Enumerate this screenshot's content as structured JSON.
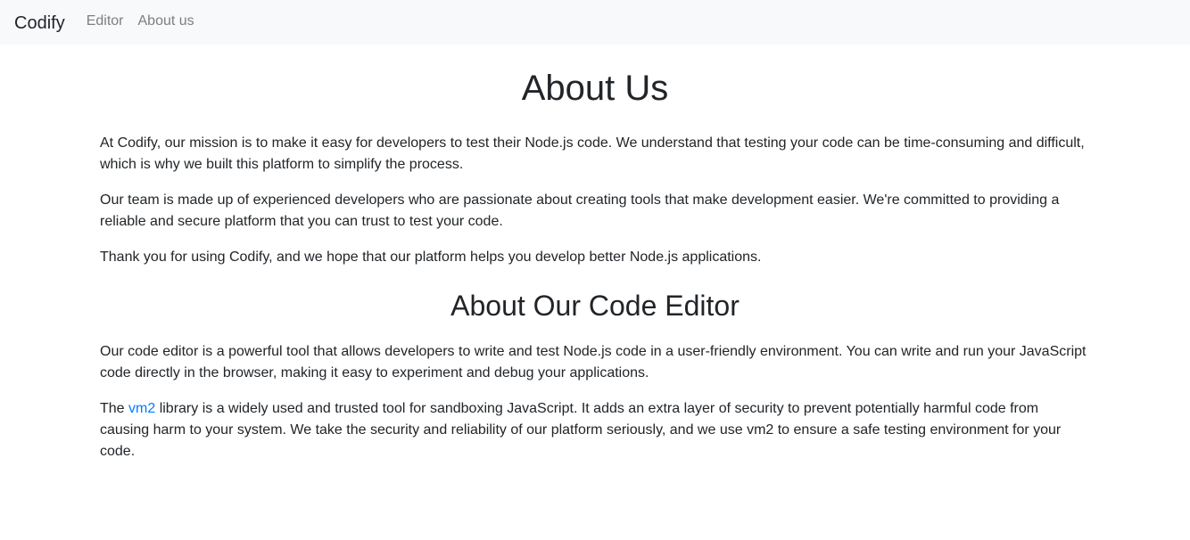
{
  "navbar": {
    "brand": "Codify",
    "links": [
      {
        "label": "Editor"
      },
      {
        "label": "About us"
      }
    ]
  },
  "about": {
    "title": "About Us",
    "paragraphs": [
      "At Codify, our mission is to make it easy for developers to test their Node.js code. We understand that testing your code can be time-consuming and difficult, which is why we built this platform to simplify the process.",
      "Our team is made up of experienced developers who are passionate about creating tools that make development easier. We're committed to providing a reliable and secure platform that you can trust to test your code.",
      "Thank you for using Codify, and we hope that our platform helps you develop better Node.js applications."
    ]
  },
  "editor_section": {
    "title": "About Our Code Editor",
    "paragraph1": "Our code editor is a powerful tool that allows developers to write and test Node.js code in a user-friendly environment. You can write and run your JavaScript code directly in the browser, making it easy to experiment and debug your applications.",
    "paragraph2_prefix": "The ",
    "paragraph2_link": "vm2",
    "paragraph2_suffix": " library is a widely used and trusted tool for sandboxing JavaScript. It adds an extra layer of security to prevent potentially harmful code from causing harm to your system. We take the security and reliability of our platform seriously, and we use vm2 to ensure a safe testing environment for your code."
  },
  "colors": {
    "navbar_bg": "#f8f9fa",
    "link": "#007bff",
    "text": "#212529",
    "nav_link": "#7b7f83"
  }
}
